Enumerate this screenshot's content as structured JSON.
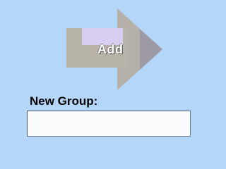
{
  "add_button": {
    "label": "Add",
    "icon": "arrow-right-icon",
    "colors": {
      "arrow_body": "#b7b3a8",
      "arrow_head": "#b5b0a8",
      "arrow_head_shade": "#9e9aa5",
      "body_highlight": "#d9cdf1"
    }
  },
  "new_group": {
    "label": "New Group:",
    "value": "",
    "placeholder": ""
  },
  "colors": {
    "background": "#b3d6f9",
    "input_background": "#fafbfd"
  }
}
